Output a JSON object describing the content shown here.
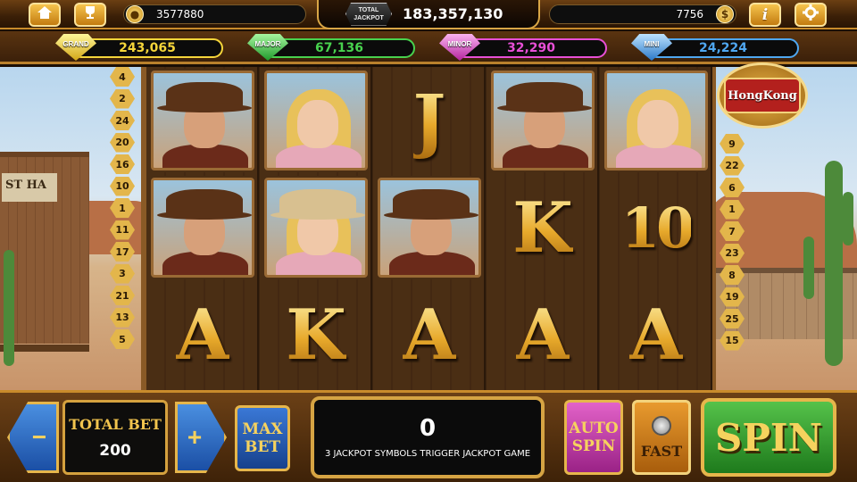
{
  "top_bar": {
    "player_coins": "3577880",
    "total_jackpot_badge": "TOTAL JACKPOT",
    "total_jackpot_value": "183,357,130",
    "right_coins": "7756",
    "icons": [
      "home-icon",
      "trophy-icon",
      "coin-icon",
      "dollar-icon",
      "info-icon",
      "gear-icon"
    ],
    "coin_symbol": "$",
    "info_symbol": "i"
  },
  "jackpots": [
    {
      "label": "GRAND",
      "value": "243,065",
      "color": "#f5d53a"
    },
    {
      "label": "MAJOR",
      "value": "67,136",
      "color": "#48d24e"
    },
    {
      "label": "MINOR",
      "value": "32,290",
      "color": "#e84fd6"
    },
    {
      "label": "MINI",
      "value": "24,224",
      "color": "#4fa7f0"
    }
  ],
  "paylines_left": [
    "4",
    "2",
    "24",
    "20",
    "16",
    "10",
    "1",
    "11",
    "17",
    "3",
    "21",
    "13",
    "5"
  ],
  "paylines_right": [
    "9",
    "22",
    "6",
    "1",
    "7",
    "23",
    "8",
    "19",
    "25",
    "15"
  ],
  "scene": {
    "saloon_sign": "ST HA",
    "room_badge": "HongKong"
  },
  "reels": [
    [
      {
        "type": "portrait",
        "kind": "cowboy"
      },
      {
        "type": "portrait",
        "kind": "cowboy"
      },
      {
        "type": "letter",
        "value": "A"
      }
    ],
    [
      {
        "type": "portrait",
        "kind": "cowgirl"
      },
      {
        "type": "portrait",
        "kind": "cowgirl-hat"
      },
      {
        "type": "letter",
        "value": "K"
      }
    ],
    [
      {
        "type": "letter",
        "value": "J"
      },
      {
        "type": "portrait",
        "kind": "cowboy"
      },
      {
        "type": "letter",
        "value": "A"
      }
    ],
    [
      {
        "type": "portrait",
        "kind": "cowboy"
      },
      {
        "type": "letter",
        "value": "K"
      },
      {
        "type": "letter",
        "value": "A"
      }
    ],
    [
      {
        "type": "portrait",
        "kind": "cowgirl"
      },
      {
        "type": "letter",
        "value": "10"
      },
      {
        "type": "letter",
        "value": "A"
      }
    ]
  ],
  "bottom_bar": {
    "decrease_symbol": "−",
    "increase_symbol": "+",
    "total_bet_label": "TOTAL BET",
    "total_bet_value": "200",
    "max_bet_label": "MAX BET",
    "win_value": "0",
    "win_message": "3 JACKPOT SYMBOLS TRIGGER JACKPOT GAME",
    "auto_spin_label": "AUTO SPIN",
    "fast_label": "FAST",
    "spin_label": "SPIN"
  }
}
